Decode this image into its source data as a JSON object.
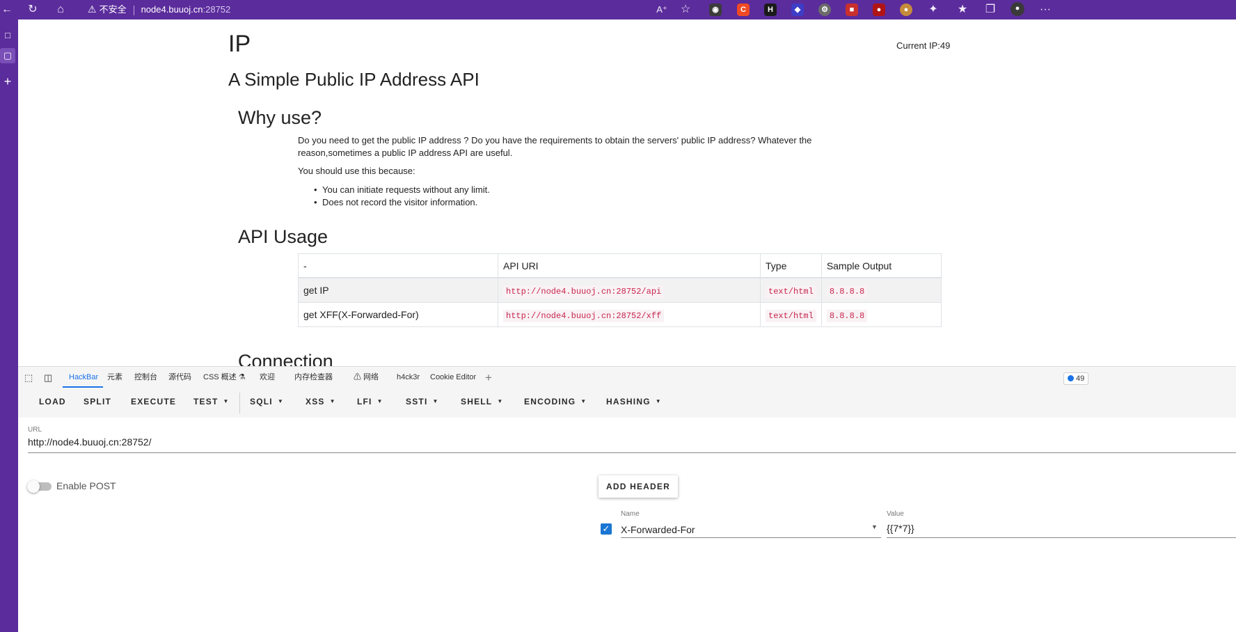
{
  "browser": {
    "security_label": "不安全",
    "address_host": "node4.buuoj.cn",
    "address_port": ":28752",
    "more_label": "···"
  },
  "page": {
    "title": "IP",
    "current_ip": "Current IP:49",
    "subtitle": "A Simple Public IP Address API",
    "why_heading": "Why use?",
    "why_text": "Do you need to get the public IP address ? Do you have the requirements to obtain the servers' public IP address? Whatever the reason,sometimes a public IP address API are useful.",
    "because_text": "You should use this because:",
    "reasons": [
      "You can initiate requests without any limit.",
      "Does not record the visitor information."
    ],
    "api_heading": "API Usage",
    "table": {
      "headers": [
        "-",
        "API URI",
        "Type",
        "Sample Output"
      ],
      "rows": [
        [
          "get IP",
          "http://node4.buuoj.cn:28752/api",
          "text/html",
          "8.8.8.8"
        ],
        [
          "get XFF(X-Forwarded-For)",
          "http://node4.buuoj.cn:28752/xff",
          "text/html",
          "8.8.8.8"
        ]
      ]
    },
    "connection_heading": "Connection"
  },
  "devtools": {
    "tabs": [
      "HackBar",
      "元素",
      "控制台",
      "源代码",
      "CSS 概述 ⚗",
      "欢迎",
      "内存检查器",
      "⚠ 网络",
      "h4ck3r",
      "Cookie Editor"
    ],
    "add_tab": "+",
    "message_count": "49"
  },
  "hackbar": {
    "toolbar": [
      "LOAD",
      "SPLIT",
      "EXECUTE",
      "TEST",
      "SQLI",
      "XSS",
      "LFI",
      "SSTI",
      "SHELL",
      "ENCODING",
      "HASHING"
    ],
    "url_label": "URL",
    "url_value": "http://node4.buuoj.cn:28752/",
    "enable_post_label": "Enable POST",
    "enable_post_on": false,
    "add_header_label": "ADD HEADER",
    "header": {
      "enabled": true,
      "name_label": "Name",
      "name_value": "X-Forwarded-For",
      "value_label": "Value",
      "value_value": "{{7*7}}"
    }
  },
  "colors": {
    "browser_chrome": "#5b2c9c",
    "code_text": "#c7254e",
    "accent": "#1976d2"
  }
}
